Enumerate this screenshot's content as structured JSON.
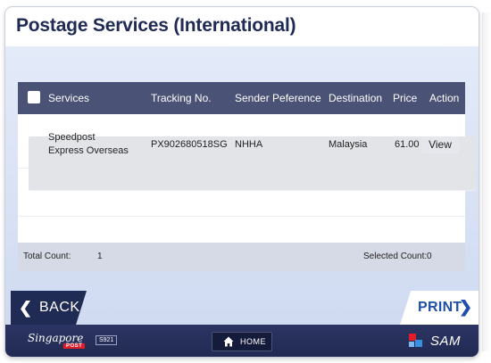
{
  "header": {
    "title": "Postage Services (International)"
  },
  "table": {
    "columns": {
      "services": "Services",
      "tracking": "Tracking No.",
      "sender": "Sender Peference",
      "destination": "Destination",
      "price": "Price",
      "action": "Action"
    },
    "rows": [
      {
        "service_line1": "Speedpost",
        "service_line2": "Express Overseas",
        "tracking": "PX902680518SG",
        "sender": "NHHA",
        "destination": "Malaysia",
        "price": "61.00",
        "action": "View"
      }
    ],
    "footer": {
      "total_label": "Total Count:",
      "total_value": "1",
      "selected_label": "Selected Count:",
      "selected_value": "0"
    }
  },
  "nav": {
    "back_label": "BACK",
    "print_label": "PRINT"
  },
  "footer": {
    "logo_script": "Singapore",
    "logo_post": "POST",
    "kiosk_id": "S921",
    "home_label": "HOME",
    "sam_label": "SAM"
  },
  "colors": {
    "header_bar": "#4a5275",
    "navy": "#1f2b55",
    "accent_blue": "#1f4fa8",
    "post_red": "#e21d2a"
  }
}
